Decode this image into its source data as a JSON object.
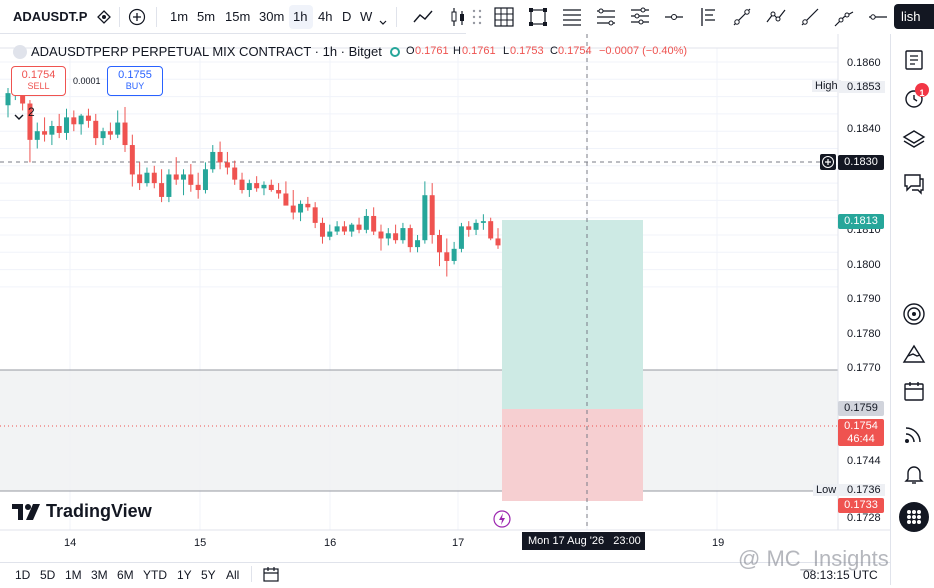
{
  "symbol": "ADAUSDT.P",
  "timeframes": [
    "1m",
    "5m",
    "15m",
    "30m",
    "1h",
    "4h",
    "D",
    "W"
  ],
  "active_timeframe": "1h",
  "publish_label": "lish",
  "legend": {
    "title": "ADAUSDTPERP PERPETUAL MIX CONTRACT · 1h · Bitget",
    "o_label": "O",
    "o": "0.1761",
    "h_label": "H",
    "h": "0.1761",
    "l_label": "L",
    "l": "0.1753",
    "c_label": "C",
    "c": "0.1754",
    "change": "−0.0007 (−0.40%)",
    "group_count": "2"
  },
  "trade": {
    "sell_price": "0.1754",
    "sell_label": "SELL",
    "spread": "0.0001",
    "buy_price": "0.1755",
    "buy_label": "BUY"
  },
  "price_axis": {
    "labels": [
      "0.1860",
      "0.1840",
      "0.1830",
      "0.1810",
      "0.1800",
      "0.1790",
      "0.1780",
      "0.1770",
      "0.1760",
      "0.1744",
      "0.1728"
    ],
    "high_label": "High",
    "high_value": "0.1853",
    "crosshair_value": "0.1830",
    "tp_value": "0.1813",
    "entry_value": "0.1759",
    "last_value": "0.1754",
    "countdown": "46:44",
    "sl_value": "0.1733",
    "low_label": "Low",
    "low_value": "0.1736"
  },
  "time_axis": {
    "labels": [
      "14",
      "15",
      "16",
      "17",
      "19"
    ],
    "crosshair_label": "Mon 17 Aug '26   23:00"
  },
  "logo_text": "TradingView",
  "watermark": "@ MC_Insights",
  "bottom": {
    "ranges": [
      "1D",
      "5D",
      "1M",
      "3M",
      "6M",
      "YTD",
      "1Y",
      "5Y",
      "All"
    ],
    "clock": "08:13:15 UTC"
  },
  "notification_count": "1",
  "colors": {
    "up": "#26a69a",
    "down": "#ef5350",
    "profit_zone": "#cdeae4",
    "loss_zone": "#f6cfd1",
    "accent": "#2962ff",
    "text": "#131722"
  },
  "candles": [
    [
      0.1835,
      0.1845,
      0.1828,
      0.1842
    ],
    [
      0.1842,
      0.185,
      0.1838,
      0.1847
    ],
    [
      0.1847,
      0.1853,
      0.1832,
      0.1836
    ],
    [
      0.1836,
      0.1838,
      0.1802,
      0.1815
    ],
    [
      0.1815,
      0.1825,
      0.181,
      0.182
    ],
    [
      0.182,
      0.1828,
      0.1814,
      0.1818
    ],
    [
      0.1818,
      0.1826,
      0.1812,
      0.1823
    ],
    [
      0.1823,
      0.183,
      0.1816,
      0.1819
    ],
    [
      0.1819,
      0.1833,
      0.1815,
      0.1828
    ],
    [
      0.1828,
      0.1832,
      0.182,
      0.1824
    ],
    [
      0.1824,
      0.183,
      0.1818,
      0.1829
    ],
    [
      0.1829,
      0.1833,
      0.1822,
      0.1826
    ],
    [
      0.1826,
      0.183,
      0.1812,
      0.1816
    ],
    [
      0.1816,
      0.1822,
      0.1812,
      0.182
    ],
    [
      0.182,
      0.1825,
      0.1815,
      0.1818
    ],
    [
      0.1818,
      0.1832,
      0.1816,
      0.1825
    ],
    [
      0.1825,
      0.1834,
      0.1808,
      0.1812
    ],
    [
      0.1812,
      0.1818,
      0.1788,
      0.1795
    ],
    [
      0.1795,
      0.1802,
      0.1786,
      0.179
    ],
    [
      0.179,
      0.1799,
      0.1788,
      0.1796
    ],
    [
      0.1796,
      0.18,
      0.1787,
      0.179
    ],
    [
      0.179,
      0.1798,
      0.1779,
      0.1782
    ],
    [
      0.1782,
      0.1798,
      0.1779,
      0.1795
    ],
    [
      0.1795,
      0.1805,
      0.1789,
      0.1792
    ],
    [
      0.1792,
      0.1798,
      0.1783,
      0.1795
    ],
    [
      0.1795,
      0.1801,
      0.1785,
      0.1789
    ],
    [
      0.1789,
      0.1796,
      0.1781,
      0.1786
    ],
    [
      0.1786,
      0.1802,
      0.1784,
      0.1798
    ],
    [
      0.1798,
      0.1812,
      0.1796,
      0.1808
    ],
    [
      0.1808,
      0.1814,
      0.1798,
      0.1802
    ],
    [
      0.1802,
      0.1808,
      0.1795,
      0.1799
    ],
    [
      0.1799,
      0.1803,
      0.1789,
      0.1792
    ],
    [
      0.1792,
      0.1796,
      0.1784,
      0.1786
    ],
    [
      0.1786,
      0.1792,
      0.1782,
      0.179
    ],
    [
      0.179,
      0.1794,
      0.1785,
      0.1787
    ],
    [
      0.1787,
      0.1791,
      0.1783,
      0.1789
    ],
    [
      0.1789,
      0.1792,
      0.1785,
      0.1786
    ],
    [
      0.1786,
      0.179,
      0.1781,
      0.1784
    ],
    [
      0.1784,
      0.1791,
      0.1779,
      0.1777
    ],
    [
      0.1777,
      0.1786,
      0.1769,
      0.1773
    ],
    [
      0.1773,
      0.178,
      0.1768,
      0.1778
    ],
    [
      0.1778,
      0.1782,
      0.1774,
      0.1776
    ],
    [
      0.1776,
      0.1779,
      0.1764,
      0.1767
    ],
    [
      0.1767,
      0.177,
      0.1755,
      0.1759
    ],
    [
      0.1759,
      0.1766,
      0.1757,
      0.1762
    ],
    [
      0.1762,
      0.1768,
      0.176,
      0.1765
    ],
    [
      0.1765,
      0.1768,
      0.176,
      0.1762
    ],
    [
      0.1762,
      0.1767,
      0.1759,
      0.1766
    ],
    [
      0.1766,
      0.177,
      0.1761,
      0.1763
    ],
    [
      0.1763,
      0.1775,
      0.1761,
      0.1771
    ],
    [
      0.1771,
      0.1776,
      0.176,
      0.1762
    ],
    [
      0.1762,
      0.1766,
      0.1751,
      0.1758
    ],
    [
      0.1758,
      0.1764,
      0.1754,
      0.1761
    ],
    [
      0.1761,
      0.1766,
      0.1755,
      0.1757
    ],
    [
      0.1757,
      0.1767,
      0.1755,
      0.1764
    ],
    [
      0.1764,
      0.1766,
      0.175,
      0.1753
    ],
    [
      0.1753,
      0.176,
      0.175,
      0.1757
    ],
    [
      0.1757,
      0.1791,
      0.1755,
      0.1783
    ],
    [
      0.1783,
      0.179,
      0.1755,
      0.176
    ],
    [
      0.176,
      0.1763,
      0.1742,
      0.175
    ],
    [
      0.175,
      0.1758,
      0.1736,
      0.1745
    ],
    [
      0.1745,
      0.1756,
      0.1743,
      0.1752
    ],
    [
      0.1752,
      0.1767,
      0.175,
      0.1765
    ],
    [
      0.1765,
      0.1768,
      0.1759,
      0.1763
    ],
    [
      0.1763,
      0.1769,
      0.176,
      0.1767
    ],
    [
      0.1767,
      0.1772,
      0.1763,
      0.1768
    ],
    [
      0.1768,
      0.177,
      0.1757,
      0.1758
    ],
    [
      0.1758,
      0.1764,
      0.1752,
      0.1754
    ]
  ]
}
